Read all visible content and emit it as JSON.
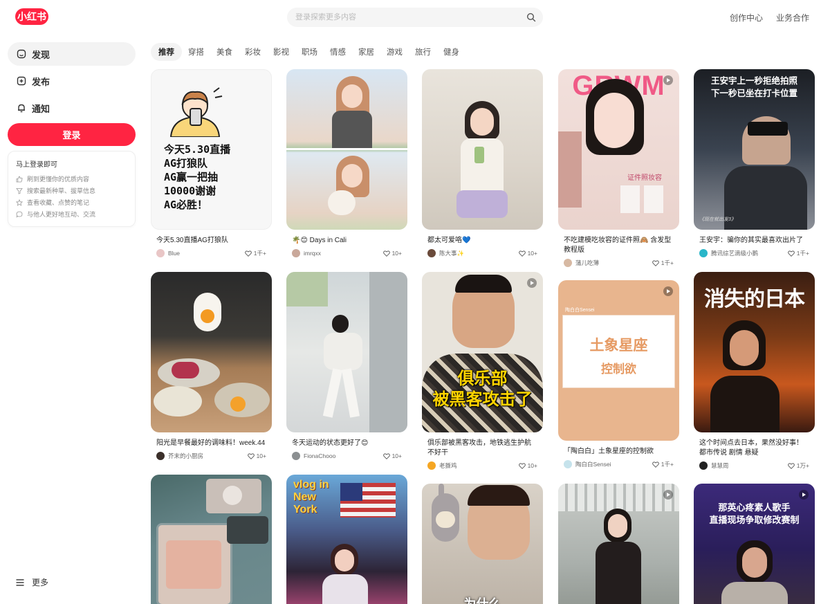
{
  "header": {
    "logo": "小红书",
    "search_placeholder": "登录探索更多内容",
    "links": [
      "创作中心",
      "业务合作"
    ]
  },
  "sidebar": {
    "items": [
      {
        "label": "发现",
        "icon": "discover-icon",
        "active": true
      },
      {
        "label": "发布",
        "icon": "publish-icon"
      },
      {
        "label": "通知",
        "icon": "bell-icon"
      }
    ],
    "login_label": "登录",
    "login_card": {
      "title": "马上登录即可",
      "perks": [
        "刷到更懂你的优质内容",
        "搜索最新种草、拔草信息",
        "查看收藏、点赞的笔记",
        "与他人更好地互动、交流"
      ]
    },
    "more_label": "更多"
  },
  "tabs": [
    "推荐",
    "穿搭",
    "美食",
    "彩妆",
    "影视",
    "职场",
    "情感",
    "家居",
    "游戏",
    "旅行",
    "健身"
  ],
  "cards": [
    {
      "title": "今天5.30直播AG打狼队",
      "author": "Blue",
      "likes": "1千+",
      "cover_text": "今天5.30直播\nAG打狼队\nAG赢一把抽\n10000谢谢\nAG必胜！"
    },
    {
      "title": "🌴😊 Days in Cali",
      "author": "imrqxx",
      "likes": "10+"
    },
    {
      "title": "都太可爱咯💙",
      "author": "陈大事✨",
      "likes": "10+"
    },
    {
      "title": "不吃建模吃妆容的证件照🙈 含发型教程版",
      "author": "蒲儿吃薄",
      "likes": "1千+",
      "cover_text": "GRWM",
      "cover_sub": "证件照妆容"
    },
    {
      "title": "王安宇：骗你的其实最喜欢出片了",
      "author": "腾讯综艺滴级小鹅",
      "likes": "1千+",
      "cover_text": "王安宇上一秒拒绝拍照\n下一秒已坐在打卡位置",
      "cover_foot": "《现在就出发3》"
    },
    {
      "title": "阳光是早餐最好的调味料！week.44",
      "author": "芥末的小厨房",
      "likes": "10+"
    },
    {
      "title": "冬天运动的状态更好了😊",
      "author": "FionaChooo",
      "likes": "10+"
    },
    {
      "title": "俱乐部被黑客攻击，地铁逃生护航不好干",
      "author": "老撕鸡",
      "likes": "10+",
      "cover_text": "俱乐部\n被黑客攻击了"
    },
    {
      "title": "「陶白白」土象星座的控制欲",
      "author": "陶白白Sensei",
      "likes": "1千+",
      "cover_text": "土象星座",
      "cover_sub": "控制欲",
      "cover_top": "陶白白Sensei"
    },
    {
      "title": "这个时间点去日本，果然没好事！都市传说 剧情 悬疑",
      "author": "慧慧周",
      "likes": "1万+",
      "cover_text": "消失的日本"
    },
    {
      "title": "",
      "author": "",
      "likes": ""
    },
    {
      "title": "",
      "author": "",
      "likes": "",
      "cover_text": "vlog in New York"
    },
    {
      "title": "",
      "author": "",
      "likes": "",
      "cover_text": "为什么"
    },
    {
      "title": "",
      "author": "",
      "likes": ""
    },
    {
      "title": "",
      "author": "",
      "likes": "",
      "cover_text": "那英心疼素人歌手\n直播现场争取修改赛制"
    }
  ],
  "colors": {
    "brand": "#ff2442"
  }
}
